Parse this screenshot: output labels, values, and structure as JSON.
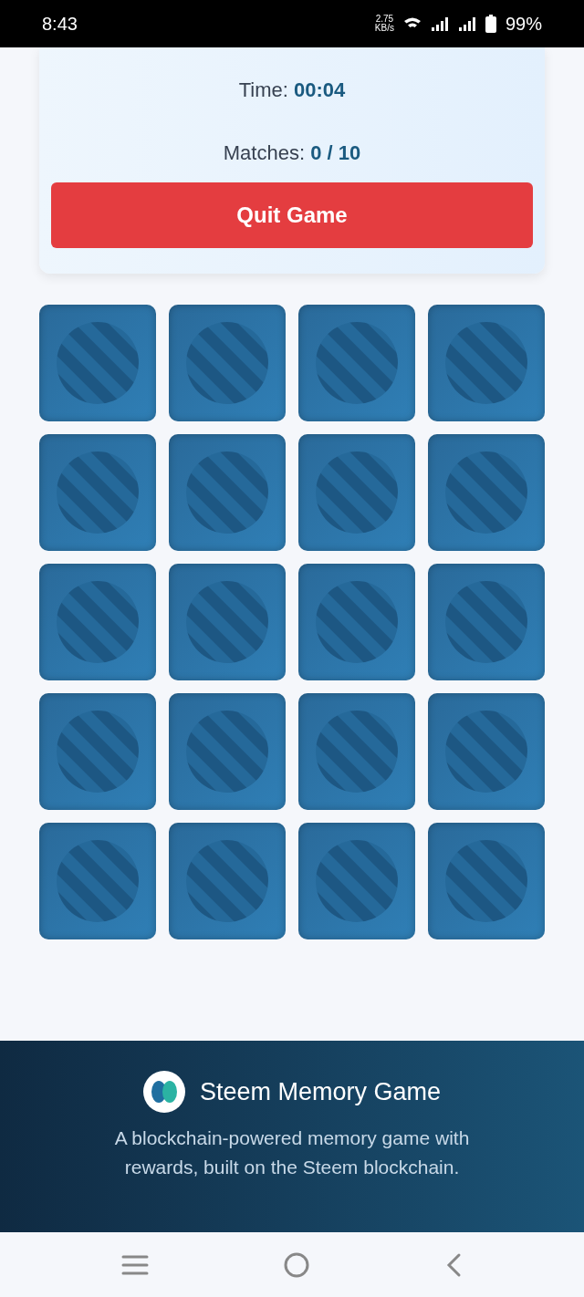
{
  "status_bar": {
    "time": "8:43",
    "speed_value": "2.75",
    "speed_unit": "KB/s",
    "battery": "99%"
  },
  "stats": [
    {
      "label": "Time:",
      "value": "00:04"
    },
    {
      "label": "Matches:",
      "value": "0 / 10"
    }
  ],
  "quit_button": "Quit Game",
  "tiles": [
    {
      "face_up": false
    },
    {
      "face_up": false
    },
    {
      "face_up": false
    },
    {
      "face_up": false
    },
    {
      "face_up": false
    },
    {
      "face_up": false
    },
    {
      "face_up": false
    },
    {
      "face_up": false
    },
    {
      "face_up": false
    },
    {
      "face_up": false
    },
    {
      "face_up": false
    },
    {
      "face_up": false
    },
    {
      "face_up": false
    },
    {
      "face_up": false
    },
    {
      "face_up": false
    },
    {
      "face_up": false
    },
    {
      "face_up": false
    },
    {
      "face_up": false
    },
    {
      "face_up": false
    },
    {
      "face_up": false
    }
  ],
  "footer": {
    "title": "Steem Memory Game",
    "description": "A blockchain-powered memory game with rewards, built on the Steem blockchain."
  }
}
